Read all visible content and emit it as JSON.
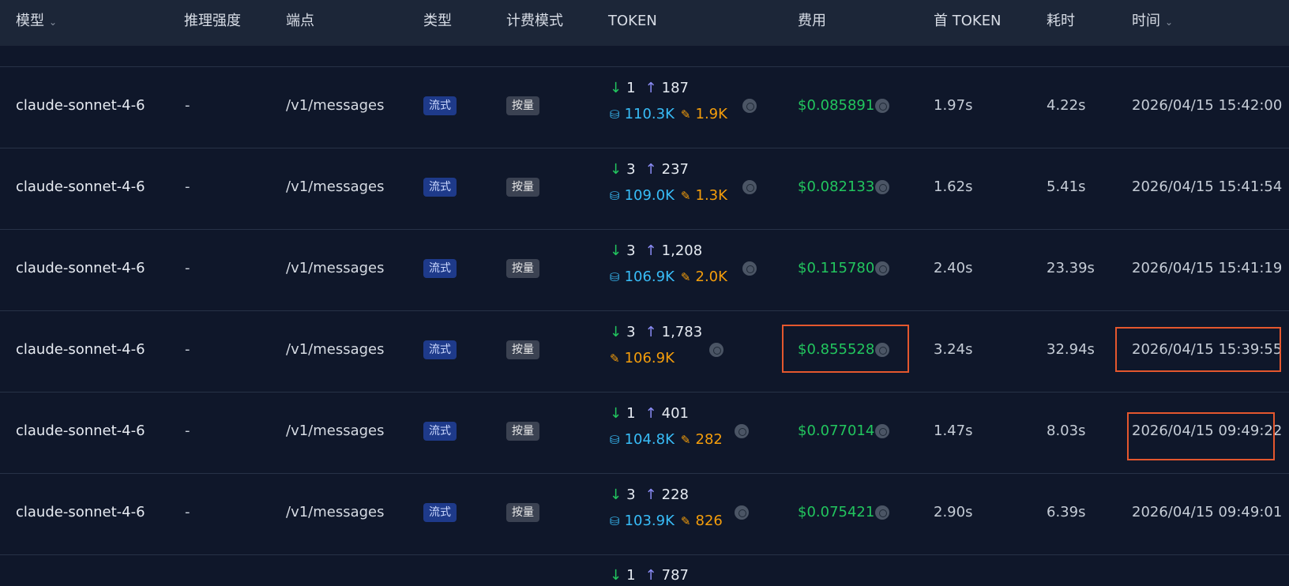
{
  "columns": {
    "model": "模型",
    "reasoning": "推理强度",
    "endpoint": "端点",
    "type": "类型",
    "billing": "计费模式",
    "token": "TOKEN",
    "cost": "费用",
    "ttft": "首 TOKEN",
    "duration": "耗时",
    "time": "时间"
  },
  "rows": [
    {
      "model": "claude-sonnet-4-6",
      "reasoning": "-",
      "endpoint": "/v1/messages",
      "type": "流式",
      "billing": "按量",
      "input": "1",
      "output": "187",
      "cache_read": "110.3K",
      "cache_write": "1.9K",
      "cost": "$0.085891",
      "ttft": "1.97s",
      "duration": "4.22s",
      "time": "2026/04/15 15:42:00"
    },
    {
      "model": "claude-sonnet-4-6",
      "reasoning": "-",
      "endpoint": "/v1/messages",
      "type": "流式",
      "billing": "按量",
      "input": "3",
      "output": "237",
      "cache_read": "109.0K",
      "cache_write": "1.3K",
      "cost": "$0.082133",
      "ttft": "1.62s",
      "duration": "5.41s",
      "time": "2026/04/15 15:41:54"
    },
    {
      "model": "claude-sonnet-4-6",
      "reasoning": "-",
      "endpoint": "/v1/messages",
      "type": "流式",
      "billing": "按量",
      "input": "3",
      "output": "1,208",
      "cache_read": "106.9K",
      "cache_write": "2.0K",
      "cost": "$0.115780",
      "ttft": "2.40s",
      "duration": "23.39s",
      "time": "2026/04/15 15:41:19"
    },
    {
      "model": "claude-sonnet-4-6",
      "reasoning": "-",
      "endpoint": "/v1/messages",
      "type": "流式",
      "billing": "按量",
      "input": "3",
      "output": "1,783",
      "cache_read": "",
      "cache_write": "106.9K",
      "cost": "$0.855528",
      "ttft": "3.24s",
      "duration": "32.94s",
      "time": "2026/04/15 15:39:55"
    },
    {
      "model": "claude-sonnet-4-6",
      "reasoning": "-",
      "endpoint": "/v1/messages",
      "type": "流式",
      "billing": "按量",
      "input": "1",
      "output": "401",
      "cache_read": "104.8K",
      "cache_write": "282",
      "cost": "$0.077014",
      "ttft": "1.47s",
      "duration": "8.03s",
      "time": "2026/04/15 09:49:22"
    },
    {
      "model": "claude-sonnet-4-6",
      "reasoning": "-",
      "endpoint": "/v1/messages",
      "type": "流式",
      "billing": "按量",
      "input": "3",
      "output": "228",
      "cache_read": "103.9K",
      "cache_write": "826",
      "cost": "$0.075421",
      "ttft": "2.90s",
      "duration": "6.39s",
      "time": "2026/04/15 09:49:01"
    }
  ],
  "partial_row": {
    "input": "1",
    "output": "787"
  },
  "colors": {
    "background": "#0f172a",
    "header": "#1c2638",
    "accent_green": "#22c55e",
    "cache_blue": "#38bdf8",
    "write_amber": "#f59e0b",
    "highlight_box": "#e4572e"
  }
}
